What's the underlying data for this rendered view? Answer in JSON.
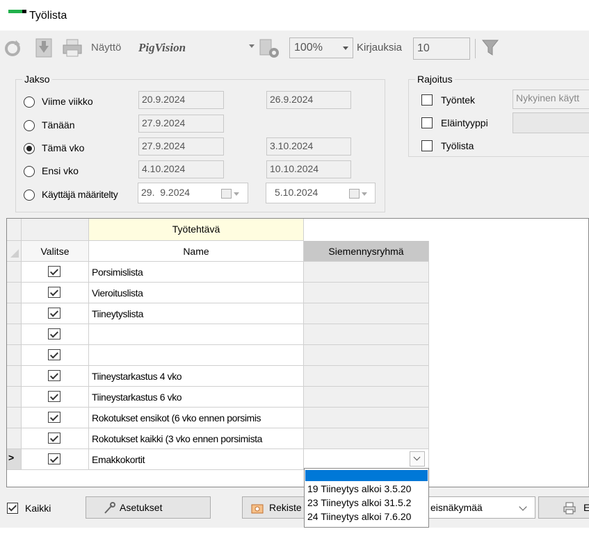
{
  "window": {
    "title": "Työlista"
  },
  "toolbar": {
    "view_label": "Näyttö",
    "view_value": "PigVision",
    "zoom_value": "100%",
    "entries_label": "Kirjauksia",
    "entries_value": "10"
  },
  "period": {
    "legend": "Jakso",
    "options": [
      {
        "label": "Viime viikko",
        "from": "20.9.2024",
        "to": "26.9.2024",
        "selected": false
      },
      {
        "label": "Tänään",
        "from": "27.9.2024",
        "to": "",
        "selected": false
      },
      {
        "label": "Tämä vko",
        "from": "27.9.2024",
        "to": "3.10.2024",
        "selected": true
      },
      {
        "label": "Ensi vko",
        "from": "4.10.2024",
        "to": "10.10.2024",
        "selected": false
      },
      {
        "label": "Käyttäjä määritelty",
        "from": "29.  9.2024",
        "to": "5.10.2024",
        "selected": false
      }
    ]
  },
  "restriction": {
    "legend": "Rajoitus",
    "items": [
      {
        "label": "Työntek",
        "value": "Nykyinen käytt"
      },
      {
        "label": "Eläintyyppi",
        "value": ""
      },
      {
        "label": "Työlista",
        "value": ""
      }
    ]
  },
  "grid": {
    "group_header": "Työtehtävä",
    "col_select": "Valitse",
    "col_name": "Name",
    "col_group": "Siemennysryhmä",
    "current_marker": ">",
    "rows": [
      {
        "checked": true,
        "name": "Porsimislista"
      },
      {
        "checked": true,
        "name": "Vieroituslista"
      },
      {
        "checked": true,
        "name": "Tiineytyslista"
      },
      {
        "checked": true,
        "name": ""
      },
      {
        "checked": true,
        "name": ""
      },
      {
        "checked": true,
        "name": "Tiineystarkastus 4 vko"
      },
      {
        "checked": true,
        "name": "Tiineystarkastus 6 vko"
      },
      {
        "checked": true,
        "name": "Rokotukset ensikot (6 vko ennen porsimis"
      },
      {
        "checked": true,
        "name": "Rokotukset kaikki (3 vko ennen porsimista"
      },
      {
        "checked": true,
        "name": "Emakkokortit"
      }
    ]
  },
  "dropdown": {
    "options": [
      "19 Tiineytys alkoi 3.5.20",
      "23 Tiineytys alkoi 31.5.2",
      "24 Tiineytys alkoi 7.6.20"
    ]
  },
  "footer": {
    "all_label": "Kaikki",
    "settings_label": "Asetukset",
    "register_label": "Rekiste",
    "view_select": "eisnäkymää",
    "last_button": "E"
  },
  "colors": {
    "accent": "#22b14c",
    "highlight": "#0078d7",
    "group_header_bg": "#fffde0",
    "col_header_gray": "#c8c8c8"
  }
}
